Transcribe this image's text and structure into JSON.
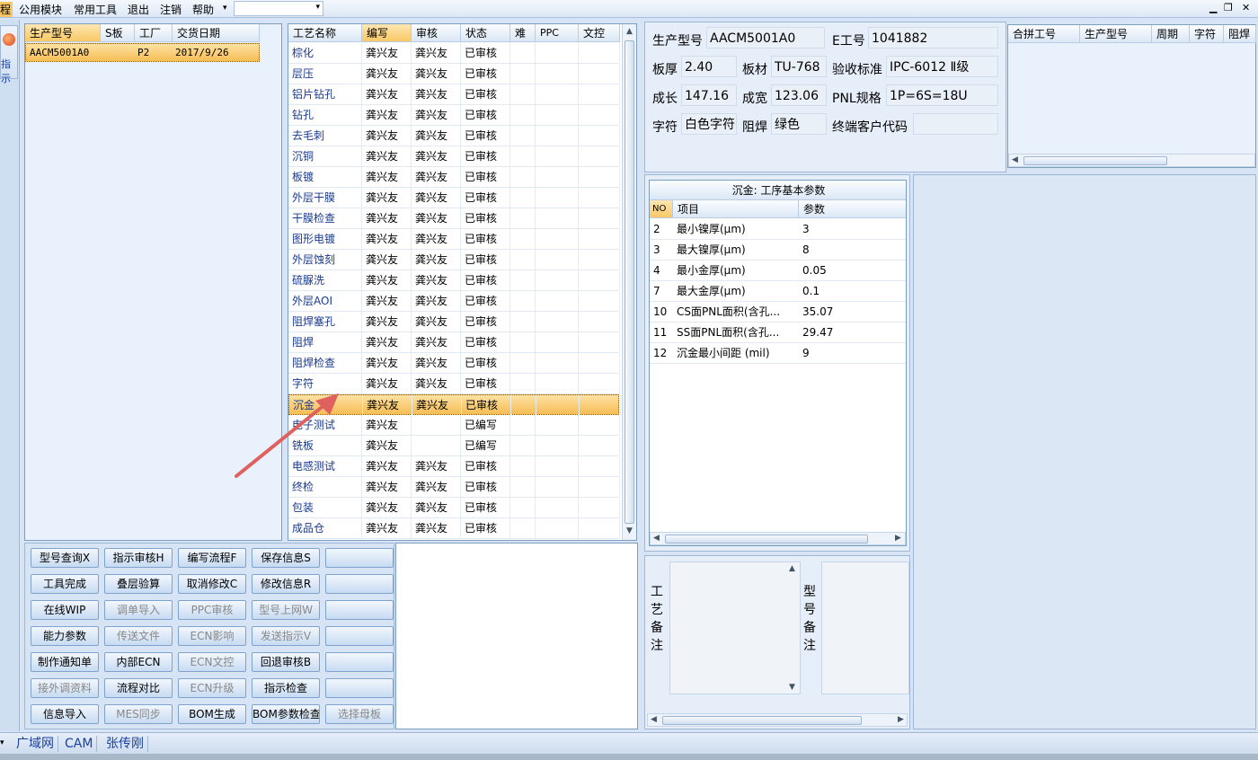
{
  "menu": {
    "items": [
      "公用模块",
      "常用工具",
      "退出",
      "注销",
      "帮助"
    ],
    "left_cut": "程",
    "dropdown_arrow": "▾"
  },
  "left_strip": {
    "label": "指示",
    "icon": "guide-icon"
  },
  "order_list": {
    "columns": [
      "生产型号",
      "S板",
      "工厂",
      "交货日期"
    ],
    "rows": [
      {
        "model": "AACM5001A0",
        "s": "",
        "factory": "P2",
        "date": "2017/9/26"
      }
    ]
  },
  "process_grid": {
    "columns": [
      "工艺名称",
      "编写",
      "审核",
      "状态",
      "难",
      "PPC",
      "文控"
    ],
    "rows": [
      {
        "name": "棕化",
        "writer": "龚兴友",
        "reviewer": "龚兴友",
        "status": "已审核"
      },
      {
        "name": "层压",
        "writer": "龚兴友",
        "reviewer": "龚兴友",
        "status": "已审核"
      },
      {
        "name": "铝片钻孔",
        "writer": "龚兴友",
        "reviewer": "龚兴友",
        "status": "已审核"
      },
      {
        "name": "钻孔",
        "writer": "龚兴友",
        "reviewer": "龚兴友",
        "status": "已审核"
      },
      {
        "name": "去毛刺",
        "writer": "龚兴友",
        "reviewer": "龚兴友",
        "status": "已审核"
      },
      {
        "name": "沉铜",
        "writer": "龚兴友",
        "reviewer": "龚兴友",
        "status": "已审核"
      },
      {
        "name": "板镀",
        "writer": "龚兴友",
        "reviewer": "龚兴友",
        "status": "已审核"
      },
      {
        "name": "外层干膜",
        "writer": "龚兴友",
        "reviewer": "龚兴友",
        "status": "已审核"
      },
      {
        "name": "干膜检查",
        "writer": "龚兴友",
        "reviewer": "龚兴友",
        "status": "已审核"
      },
      {
        "name": "图形电镀",
        "writer": "龚兴友",
        "reviewer": "龚兴友",
        "status": "已审核"
      },
      {
        "name": "外层蚀刻",
        "writer": "龚兴友",
        "reviewer": "龚兴友",
        "status": "已审核"
      },
      {
        "name": "硫脲洗",
        "writer": "龚兴友",
        "reviewer": "龚兴友",
        "status": "已审核"
      },
      {
        "name": "外层AOI",
        "writer": "龚兴友",
        "reviewer": "龚兴友",
        "status": "已审核"
      },
      {
        "name": "阻焊塞孔",
        "writer": "龚兴友",
        "reviewer": "龚兴友",
        "status": "已审核"
      },
      {
        "name": "阻焊",
        "writer": "龚兴友",
        "reviewer": "龚兴友",
        "status": "已审核"
      },
      {
        "name": "阻焊检查",
        "writer": "龚兴友",
        "reviewer": "龚兴友",
        "status": "已审核"
      },
      {
        "name": "字符",
        "writer": "龚兴友",
        "reviewer": "龚兴友",
        "status": "已审核"
      },
      {
        "name": "沉金",
        "writer": "龚兴友",
        "reviewer": "龚兴友",
        "status": "已审核"
      },
      {
        "name": "电子测试",
        "writer": "龚兴友",
        "reviewer": "",
        "status": "已编写"
      },
      {
        "name": "铣板",
        "writer": "龚兴友",
        "reviewer": "",
        "status": "已编写"
      },
      {
        "name": "电感测试",
        "writer": "龚兴友",
        "reviewer": "龚兴友",
        "status": "已审核"
      },
      {
        "name": "终检",
        "writer": "龚兴友",
        "reviewer": "龚兴友",
        "status": "已审核"
      },
      {
        "name": "包装",
        "writer": "龚兴友",
        "reviewer": "龚兴友",
        "status": "已审核"
      },
      {
        "name": "成品仓",
        "writer": "龚兴友",
        "reviewer": "龚兴友",
        "status": "已审核"
      }
    ],
    "selected_index": 17
  },
  "buttons": [
    [
      "型号查询X",
      "指示审核H",
      "编写流程F",
      "保存信息S",
      ""
    ],
    [
      "工具完成",
      "叠层验算",
      "取消修改C",
      "修改信息R",
      ""
    ],
    [
      "在线WIP",
      "调单导入",
      "PPC审核",
      "型号上网W",
      ""
    ],
    [
      "能力参数",
      "传送文件",
      "ECN影响",
      "发送指示V",
      ""
    ],
    [
      "制作通知单",
      "内部ECN",
      "ECN文控",
      "回退审核B",
      ""
    ],
    [
      "接外调资料",
      "流程对比",
      "ECN升级",
      "指示检查",
      ""
    ],
    [
      "信息导入",
      "MES同步",
      "BOM生成",
      "BOM参数检查",
      "选择母板"
    ]
  ],
  "disabled_buttons": [
    "调单导入",
    "PPC审核",
    "型号上网W",
    "传送文件",
    "ECN影响",
    "发送指示V",
    "ECN文控",
    "接外调资料",
    "ECN升级",
    "MES同步",
    "选择母板"
  ],
  "info": {
    "model_label": "生产型号",
    "model": "AACM5001A0",
    "eno_label": "E工号",
    "eno": "1041882",
    "thickness_label": "板厚",
    "thickness": "2.40",
    "material_label": "板材",
    "material": "TU-768",
    "standard_label": "验收标准",
    "standard": "IPC-6012 Ⅱ级",
    "length_label": "成长",
    "length": "147.16",
    "width_label": "成宽",
    "width": "123.06",
    "pnl_label": "PNL规格",
    "pnl": "1P=6S=18U",
    "char_label": "字符",
    "char": "白色字符",
    "mask_label": "阻焊",
    "mask": "绿色",
    "endcode_label": "终端客户代码",
    "endcode": ""
  },
  "merge_grid": {
    "columns": [
      "合拼工号",
      "生产型号",
      "周期",
      "字符",
      "阻焊"
    ]
  },
  "param_panel": {
    "title": "沉金: 工序基本参数",
    "columns": [
      "NO",
      "项目",
      "参数"
    ],
    "rows": [
      {
        "no": "2",
        "item": "最小镍厚(μm)",
        "value": "3"
      },
      {
        "no": "3",
        "item": "最大镍厚(μm)",
        "value": "8"
      },
      {
        "no": "4",
        "item": "最小金厚(μm)",
        "value": "0.05"
      },
      {
        "no": "7",
        "item": "最大金厚(μm)",
        "value": "0.1"
      },
      {
        "no": "10",
        "item": "CS面PNL面积(含孔...",
        "value": "35.07"
      },
      {
        "no": "11",
        "item": "SS面PNL面积(含孔...",
        "value": "29.47"
      },
      {
        "no": "12",
        "item": "沉金最小间距 (mil)",
        "value": "9"
      }
    ]
  },
  "remarks": {
    "process_label": "工艺备注",
    "model_label": "型号备注"
  },
  "status_bar": {
    "items": [
      "广域网",
      "CAM",
      "张传刚"
    ]
  },
  "colors": {
    "accent": "#f7bd55",
    "link": "#1a3a8a",
    "panel_bg": "#d6e4f5",
    "annotation_arrow": "#e06060"
  }
}
